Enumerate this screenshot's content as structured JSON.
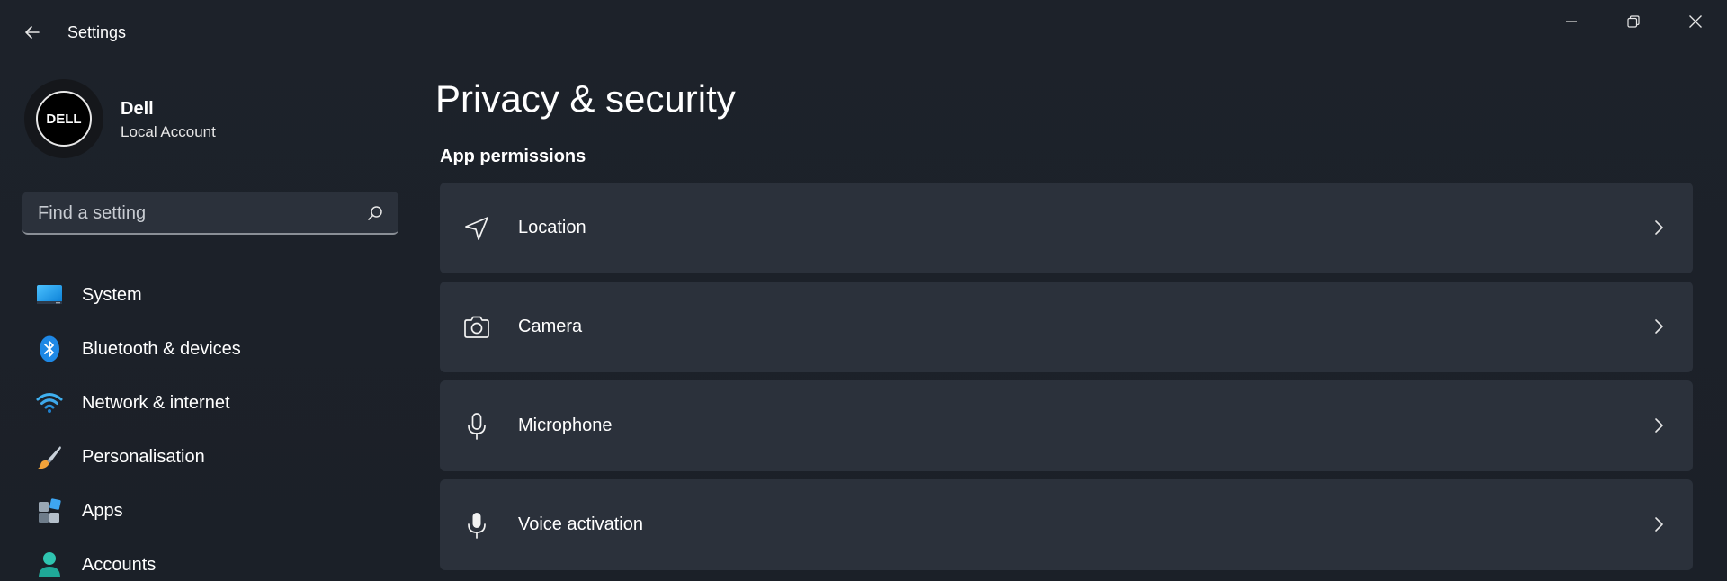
{
  "app": {
    "title": "Settings"
  },
  "profile": {
    "name": "Dell",
    "account_type": "Local Account",
    "logo_text": "DELL"
  },
  "search": {
    "placeholder": "Find a setting"
  },
  "sidebar": {
    "items": [
      {
        "label": "System",
        "icon": "system-monitor-icon"
      },
      {
        "label": "Bluetooth & devices",
        "icon": "bluetooth-icon"
      },
      {
        "label": "Network & internet",
        "icon": "wifi-icon"
      },
      {
        "label": "Personalisation",
        "icon": "paintbrush-icon"
      },
      {
        "label": "Apps",
        "icon": "apps-icon"
      },
      {
        "label": "Accounts",
        "icon": "accounts-icon"
      }
    ]
  },
  "main": {
    "title": "Privacy & security",
    "section": "App permissions",
    "cards": [
      {
        "label": "Location",
        "icon": "location-icon"
      },
      {
        "label": "Camera",
        "icon": "camera-icon"
      },
      {
        "label": "Microphone",
        "icon": "microphone-icon"
      },
      {
        "label": "Voice activation",
        "icon": "voice-activation-icon"
      }
    ]
  },
  "colors": {
    "background": "#1c2129",
    "card": "#2b313b",
    "accent": "#0078d4"
  }
}
